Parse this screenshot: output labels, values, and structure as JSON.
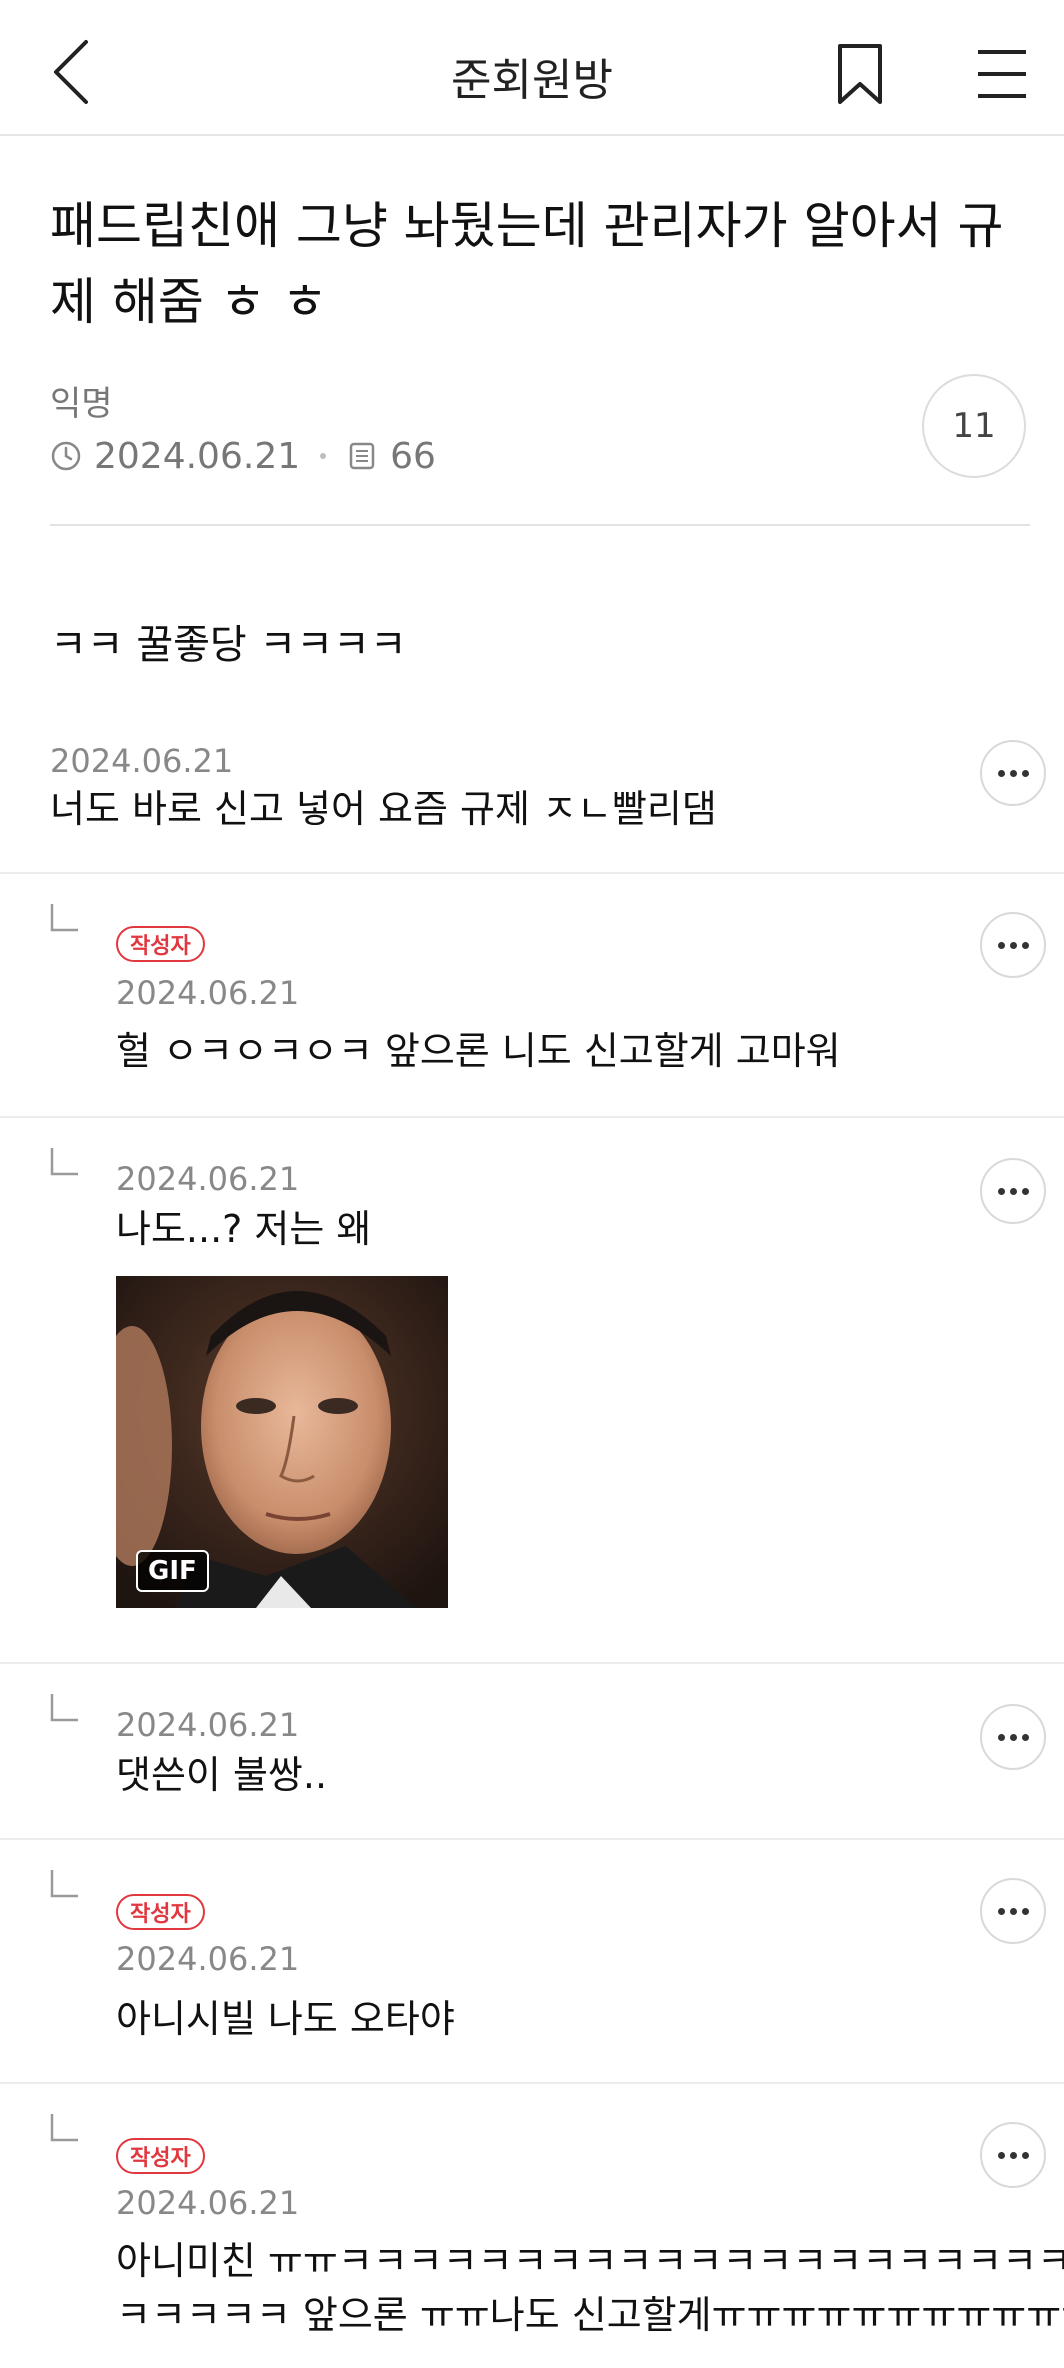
{
  "header": {
    "title": "준회원방",
    "back_icon": "chevron-left-icon",
    "bookmark_icon": "bookmark-icon",
    "menu_icon": "hamburger-menu-icon"
  },
  "post": {
    "title": "패드립친애 그냥 놔뒀는데 관리자가 알아서 규제 해줌 ㅎ ㅎ",
    "author": "익명",
    "date": "2024.06.21",
    "views": "66",
    "comment_count": "11",
    "body": "ㅋㅋ 꿀좋당 ㅋㅋㅋㅋ"
  },
  "author_badge": "작성자",
  "gif_label": "GIF",
  "comments": [
    {
      "date": "2024.06.21",
      "text": "너도 바로 신고 넣어 요즘 규제 ㅈㄴ빨리댐"
    },
    {
      "date": "2024.06.21",
      "text": "헐 ㅇㅋㅇㅋㅇㅋ 앞으론 니도 신고할게 고마워",
      "is_author": true
    },
    {
      "date": "2024.06.21",
      "text": "나도...? 저는 왜"
    },
    {
      "date": "2024.06.21",
      "text": "댓쓴이 불쌍.."
    },
    {
      "date": "2024.06.21",
      "text": "아니시빌 나도 오타야",
      "is_author": true
    },
    {
      "date": "2024.06.21",
      "text_line1": "아니미친 ㅠㅠㅋㅋㅋㅋㅋㅋㅋㅋㅋㅋㅋㅋㅋㅋㅋㅋㅋㅋㅋㅋㅋㅋ",
      "text_line2": "ㅋㅋㅋㅋㅋ 앞으론 ㅠㅠ나도 신고할게ㅠㅠㅠㅠㅠㅠㅠㅠㅠㅠㅠ",
      "is_author": true
    }
  ],
  "colors": {
    "badge_red": "#e0383e",
    "meta_gray": "#777777",
    "divider": "#e6e6e6"
  }
}
